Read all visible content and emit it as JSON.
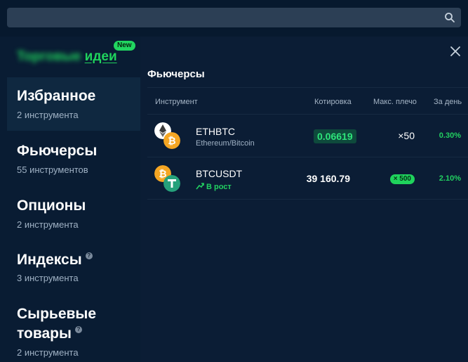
{
  "search": {
    "placeholder": ""
  },
  "sidebar": {
    "brand_blurred": "Торговые",
    "brand_link": "идеи",
    "new_badge": "New",
    "items": [
      {
        "title": "Избранное",
        "subtitle": "2 инструмента"
      },
      {
        "title": "Фьючерсы",
        "subtitle": "55 инструментов"
      },
      {
        "title": "Опционы",
        "subtitle": "2 инструмента"
      },
      {
        "title": "Индексы",
        "subtitle": "3 инструмента"
      },
      {
        "title_line1": "Сырьевые",
        "title_line2": "товары",
        "subtitle": "2 инструмента"
      }
    ],
    "help_mark": "?"
  },
  "panel": {
    "title": "Фьючерсы",
    "columns": {
      "instrument": "Инструмент",
      "quote": "Котировка",
      "leverage": "Макс. плечо",
      "change": "За день"
    },
    "rows": [
      {
        "symbol": "ETHBTC",
        "subtitle": "Ethereum/Bitcoin",
        "quote": "0.06619",
        "leverage": "×50",
        "change": "0.30%"
      },
      {
        "symbol": "BTCUSDT",
        "tag": "В рост",
        "quote": "39 160.79",
        "leverage": "× 500",
        "change": "2.10%"
      }
    ]
  },
  "colors": {
    "accent_green": "#1fd35c",
    "background": "#07192e",
    "panel": "#0b1d35"
  },
  "icons": [
    "search-icon",
    "close-icon",
    "ethereum-icon",
    "bitcoin-icon",
    "tether-icon",
    "trend-up-icon"
  ]
}
